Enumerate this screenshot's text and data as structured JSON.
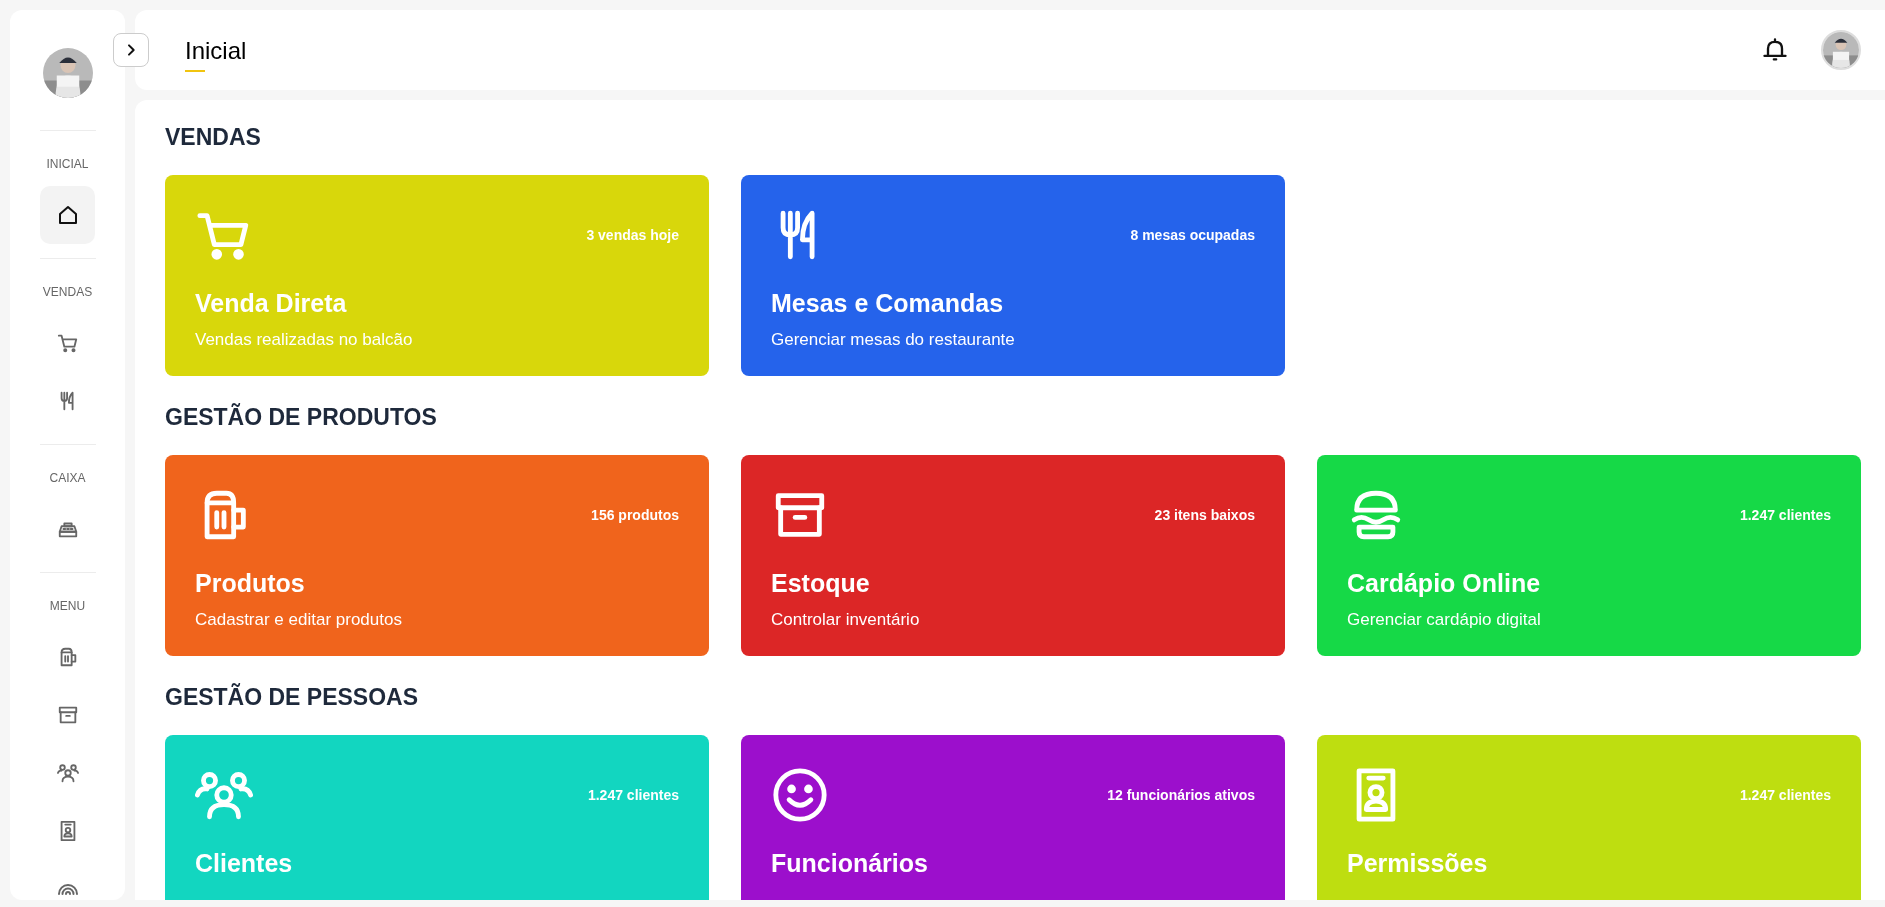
{
  "sidebar": {
    "sections": [
      {
        "label": "INICIAL",
        "items": [
          {
            "kind": "home",
            "selected": true
          }
        ]
      },
      {
        "label": "VENDAS",
        "items": [
          {
            "kind": "cart",
            "selected": false
          },
          {
            "kind": "fork",
            "selected": false
          }
        ]
      },
      {
        "label": "CAIXA",
        "items": [
          {
            "kind": "register",
            "selected": false
          }
        ]
      },
      {
        "label": "MENU",
        "items": [
          {
            "kind": "mug",
            "selected": false
          },
          {
            "kind": "box",
            "selected": false
          },
          {
            "kind": "people",
            "selected": false
          },
          {
            "kind": "badge",
            "selected": false
          },
          {
            "kind": "rings",
            "selected": false
          }
        ]
      }
    ]
  },
  "header": {
    "title": "Inicial"
  },
  "sections": [
    {
      "title": "VENDAS",
      "cards": [
        {
          "kind": "cart",
          "color": "#d8d70b",
          "stat": "3 vendas hoje",
          "title": "Venda Direta",
          "subtitle": "Vendas realizadas no balcão"
        },
        {
          "kind": "fork",
          "color": "#2563eb",
          "stat": "8 mesas ocupadas",
          "title": "Mesas e Comandas",
          "subtitle": "Gerenciar mesas do restaurante"
        }
      ]
    },
    {
      "title": "GESTÃO DE PRODUTOS",
      "cards": [
        {
          "kind": "mug",
          "color": "#f0641c",
          "stat": "156 produtos",
          "title": "Produtos",
          "subtitle": "Cadastrar e editar produtos"
        },
        {
          "kind": "box",
          "color": "#dc2626",
          "stat": "23 itens baixos",
          "title": "Estoque",
          "subtitle": "Controlar inventário"
        },
        {
          "kind": "burger",
          "color": "#16d947",
          "stat": "1.247 clientes",
          "title": "Cardápio Online",
          "subtitle": "Gerenciar cardápio digital"
        }
      ]
    },
    {
      "title": "GESTÃO DE PESSOAS",
      "cards": [
        {
          "kind": "people",
          "color": "#12d6c0",
          "stat": "1.247 clientes",
          "title": "Clientes"
        },
        {
          "kind": "smile",
          "color": "#9c0fcc",
          "stat": "12 funcionários ativos",
          "title": "Funcionários"
        },
        {
          "kind": "badge",
          "color": "#bede10",
          "stat": "1.247 clientes",
          "title": "Permissões"
        }
      ]
    }
  ]
}
